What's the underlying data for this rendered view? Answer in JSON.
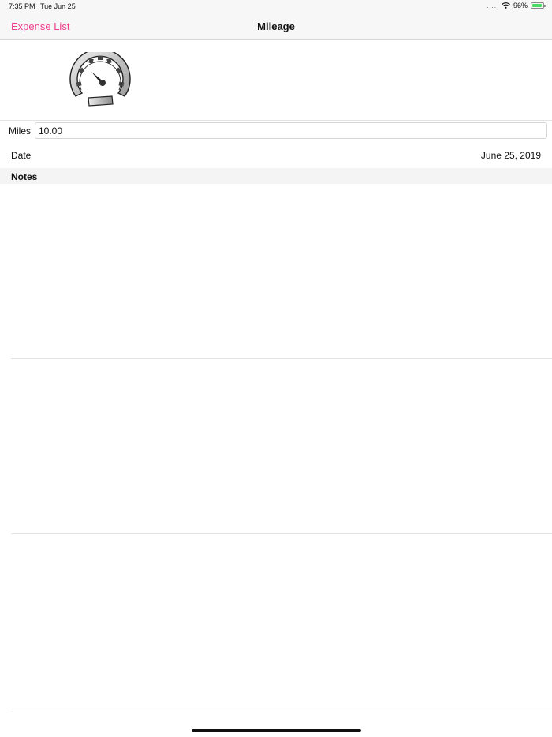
{
  "status_bar": {
    "time": "7:35 PM",
    "date": "Tue Jun 25",
    "signal": "....",
    "battery_percent": "96%",
    "battery_level": 0.96,
    "battery_color": "#4cd964"
  },
  "nav": {
    "back_label": "Expense List",
    "title": "Mileage",
    "accent_color": "#ee3d8f"
  },
  "header_icon": "speedometer-icon",
  "miles": {
    "label": "Miles",
    "value": "10.00",
    "placeholder": ""
  },
  "date": {
    "label": "Date",
    "value": "June 25, 2019"
  },
  "notes": {
    "header": "Notes",
    "value": ""
  }
}
